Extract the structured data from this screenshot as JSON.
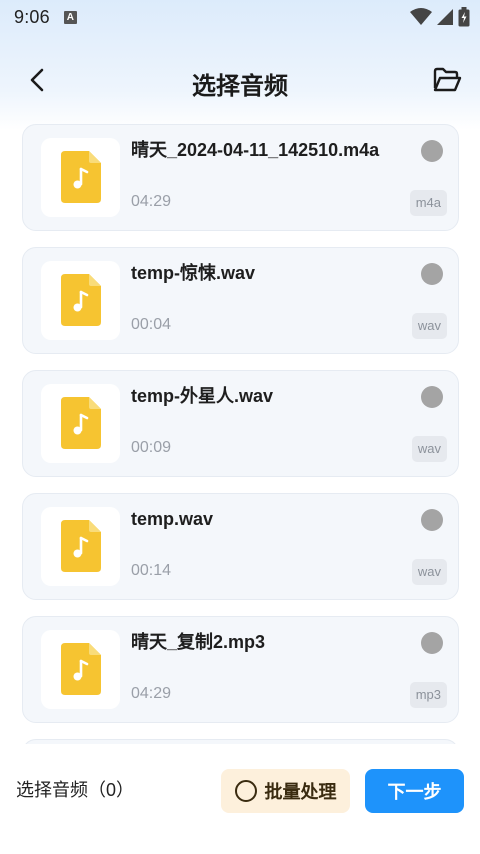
{
  "status_bar": {
    "time": "9:06",
    "notification_icon_letter": "A"
  },
  "header": {
    "title": "选择音频"
  },
  "files": [
    {
      "name": "晴天_2024-04-11_142510.m4a",
      "duration": "04:29",
      "ext": "m4a"
    },
    {
      "name": "temp-惊悚.wav",
      "duration": "00:04",
      "ext": "wav"
    },
    {
      "name": "temp-外星人.wav",
      "duration": "00:09",
      "ext": "wav"
    },
    {
      "name": "temp.wav",
      "duration": "00:14",
      "ext": "wav"
    },
    {
      "name": "晴天_复制2.mp3",
      "duration": "04:29",
      "ext": "mp3"
    }
  ],
  "bottom": {
    "selected_label": "选择音频（0）",
    "batch_label": "批量处理",
    "next_label": "下一步"
  },
  "colors": {
    "accent": "#1e93fb",
    "batch_bg": "#fdf0dc",
    "music_icon": "#f6c431"
  },
  "icons": {
    "back": "back-arrow-icon",
    "folder": "folder-icon",
    "file": "music-file-icon"
  }
}
